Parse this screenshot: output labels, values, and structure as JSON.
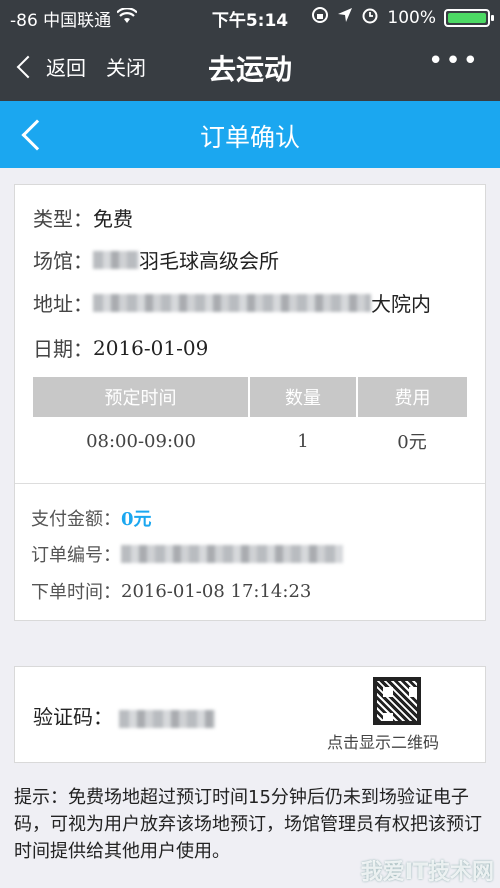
{
  "status": {
    "carrier": "-86 中国联通",
    "time": "下午5:14",
    "battery": "100%"
  },
  "nav": {
    "back_label": "返回",
    "close_label": "关闭",
    "title": "去运动",
    "more": "•••"
  },
  "header": {
    "title": "订单确认"
  },
  "order": {
    "type_label": "类型：",
    "type_value": "免费",
    "venue_label": "场馆：",
    "venue_value": "羽毛球高级会所",
    "address_label": "地址：",
    "address_value": "大院内",
    "date_label": "日期：",
    "date_value": "2016-01-09",
    "columns": [
      "预定时间",
      "数量",
      "费用"
    ],
    "rows": [
      {
        "time": "08:00-09:00",
        "qty": "1",
        "fee": "0元"
      }
    ],
    "pay_label": "支付金额：",
    "pay_value": "0元",
    "order_no_label": "订单编号：",
    "order_time_label": "下单时间：",
    "order_time_value": "2016-01-08 17:14:23"
  },
  "verify": {
    "label": "验证码：",
    "qr_text": "点击显示二维码"
  },
  "tip": "提示：免费场地超过预订时间15分钟后仍未到场验证电子码，可视为用户放弃该场地预订，场馆管理员有权把该预订时间提供给其他用户使用。",
  "watermark": "我爱IT技术网",
  "colors": {
    "accent": "#1ba7f0",
    "nav_bg": "#383d42",
    "battery": "#4cd964"
  }
}
